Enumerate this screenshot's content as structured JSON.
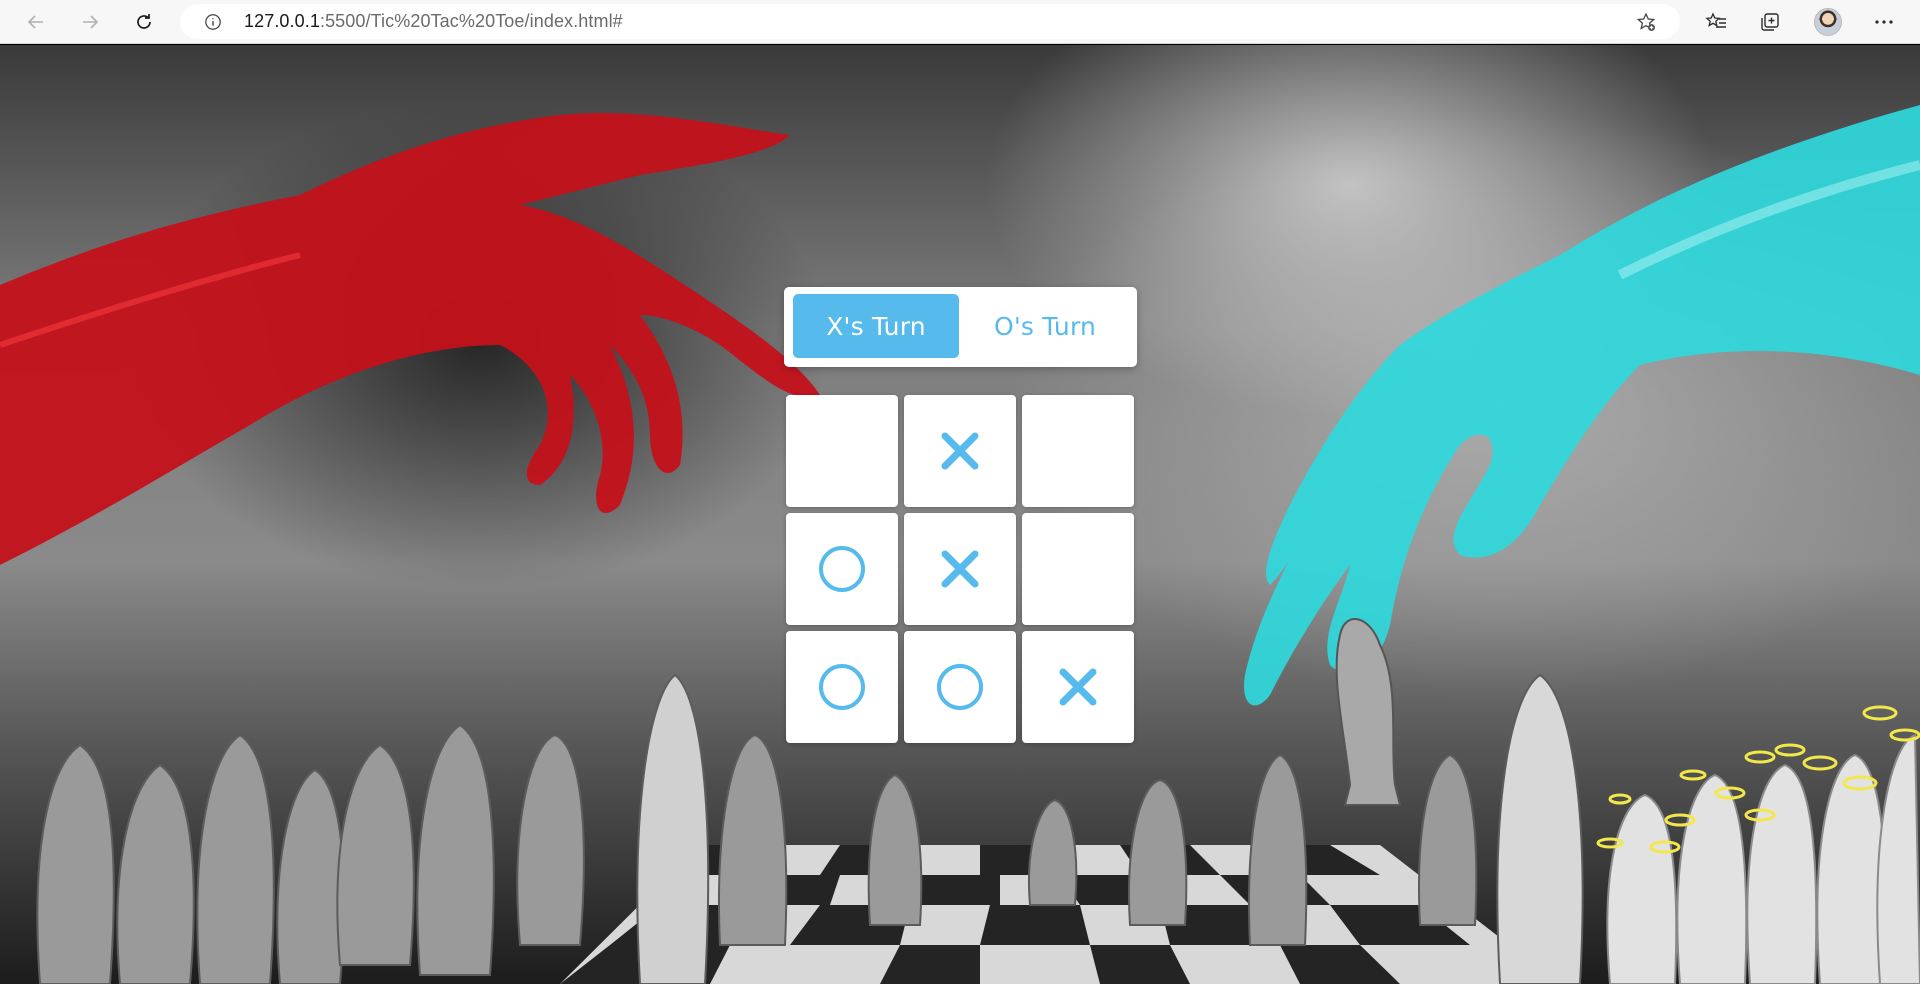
{
  "browser": {
    "url_host": "127.0.0.1",
    "url_path": ":5500/Tic%20Tac%20Toe/index.html#"
  },
  "turn": {
    "x_label": "X's Turn",
    "o_label": "O's Turn",
    "active": "X"
  },
  "board": {
    "cells": [
      "",
      "X",
      "",
      "O",
      "X",
      "",
      "O",
      "O",
      "X"
    ]
  },
  "colors": {
    "accent": "#56baed",
    "tile": "#ffffff"
  },
  "icons": [
    "back-arrow-icon",
    "forward-arrow-icon",
    "refresh-icon",
    "info-icon",
    "add-favorite-icon",
    "favorites-icon",
    "collections-icon",
    "profile-avatar",
    "more-icon"
  ]
}
